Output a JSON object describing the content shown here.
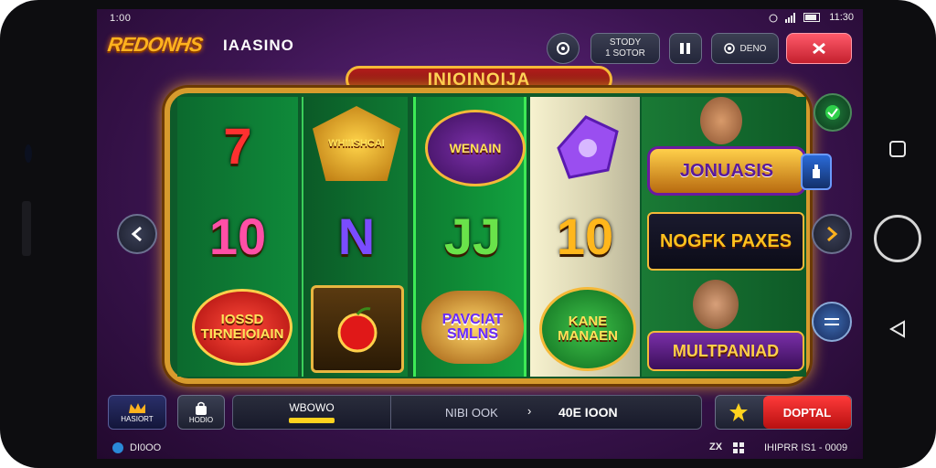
{
  "status_bar": {
    "time": "1:00",
    "right_text": "11:30"
  },
  "header": {
    "logo": "REDONHS",
    "brand": "IAASINO",
    "buttons": [
      {
        "icon": "settings-icon"
      },
      {
        "line1": "STODY",
        "line2": "1 SOTOR"
      },
      {
        "icon": "menu-icon"
      },
      {
        "label": "DENO",
        "icon": "record-icon"
      },
      {
        "icon": "close-icon",
        "accent": "#e02a3a"
      }
    ]
  },
  "banner": {
    "title": "INIOINOIJA"
  },
  "reels": {
    "col1": [
      "7",
      "10",
      "IOSSD TIRNEIOIAIN"
    ],
    "col2": [
      "WHIIISHCAI",
      "N",
      "cherry"
    ],
    "col3": [
      "WENAIN",
      "JJ",
      "PAVCIAT SMLNS"
    ],
    "col4": [
      "gem",
      "10",
      "KANE MANAEN"
    ],
    "col5": [
      "JONUASIS",
      "NOGFK PAXES",
      "MULTPANIAD"
    ]
  },
  "bottom_bar": {
    "left_label": "HASIORT",
    "bag_label": "HODIO",
    "wallet_label": "WBOWO",
    "bet_label": "NIBI OOK",
    "amount": "40E IOON",
    "spin_label": "DOPTAL"
  },
  "footer": {
    "left": "DI0OO",
    "right_icon": "ZX",
    "right": "IHIPRR IS1 - 0009"
  },
  "colors": {
    "gold": "#d79b2d",
    "accent_red": "#e02a3a",
    "felt": "#0f8a3a"
  }
}
